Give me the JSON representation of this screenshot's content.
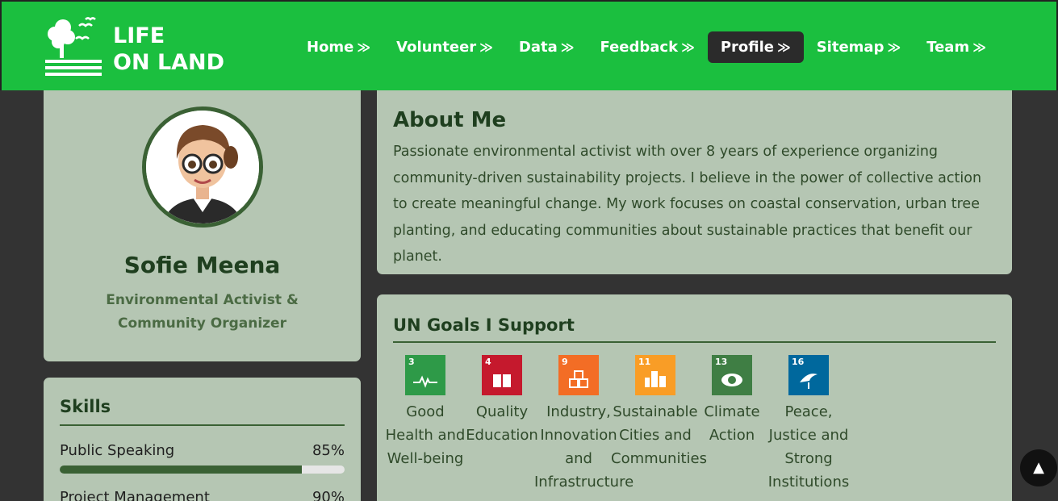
{
  "brand": {
    "line1": "LIFE",
    "line2": "ON LAND"
  },
  "nav": {
    "items": [
      {
        "label": "Home",
        "chevron": "≫"
      },
      {
        "label": "Volunteer",
        "chevron": "≫"
      },
      {
        "label": "Data",
        "chevron": "≫"
      },
      {
        "label": "Feedback",
        "chevron": "≫"
      },
      {
        "label": "Profile",
        "chevron": "≫"
      },
      {
        "label": "Sitemap",
        "chevron": "≫"
      },
      {
        "label": "Team",
        "chevron": "≫"
      }
    ],
    "active": "Profile"
  },
  "profile": {
    "name": "Sofie Meena",
    "role": "Environmental Activist & Community Organizer"
  },
  "skills": {
    "title": "Skills",
    "items": [
      {
        "name": "Public Speaking",
        "percent_label": "85%",
        "level": 85
      },
      {
        "name": "Project Management",
        "percent_label": "90%",
        "level": 90
      }
    ]
  },
  "about": {
    "title": "About Me",
    "text": "Passionate environmental activist with over 8 years of experience organizing community-driven sustainability projects. I believe in the power of collective action to create meaningful change. My work focuses on coastal conservation, urban tree planting, and educating communities about sustainable practices that benefit our planet."
  },
  "goals": {
    "title": "UN Goals I Support",
    "items": [
      {
        "number": "3",
        "label": "Good Health and Well-being",
        "color": "#2e9a48"
      },
      {
        "number": "4",
        "label": "Quality Education",
        "color": "#c5192d"
      },
      {
        "number": "9",
        "label": "Industry, Innovation and Infrastructure",
        "color": "#f36d25"
      },
      {
        "number": "11",
        "label": "Sustainable Cities and Communities",
        "color": "#f99d26"
      },
      {
        "number": "13",
        "label": "Climate Action",
        "color": "#3f7e44"
      },
      {
        "number": "16",
        "label": "Peace, Justice and Strong Institutions",
        "color": "#00689d"
      }
    ]
  },
  "colors": {
    "header": "#1bbf3f",
    "active_nav": "#2b2b2b",
    "card": "#b5c6b3",
    "accent": "#3a6134"
  },
  "back_to_top": {
    "icon": "▲"
  }
}
